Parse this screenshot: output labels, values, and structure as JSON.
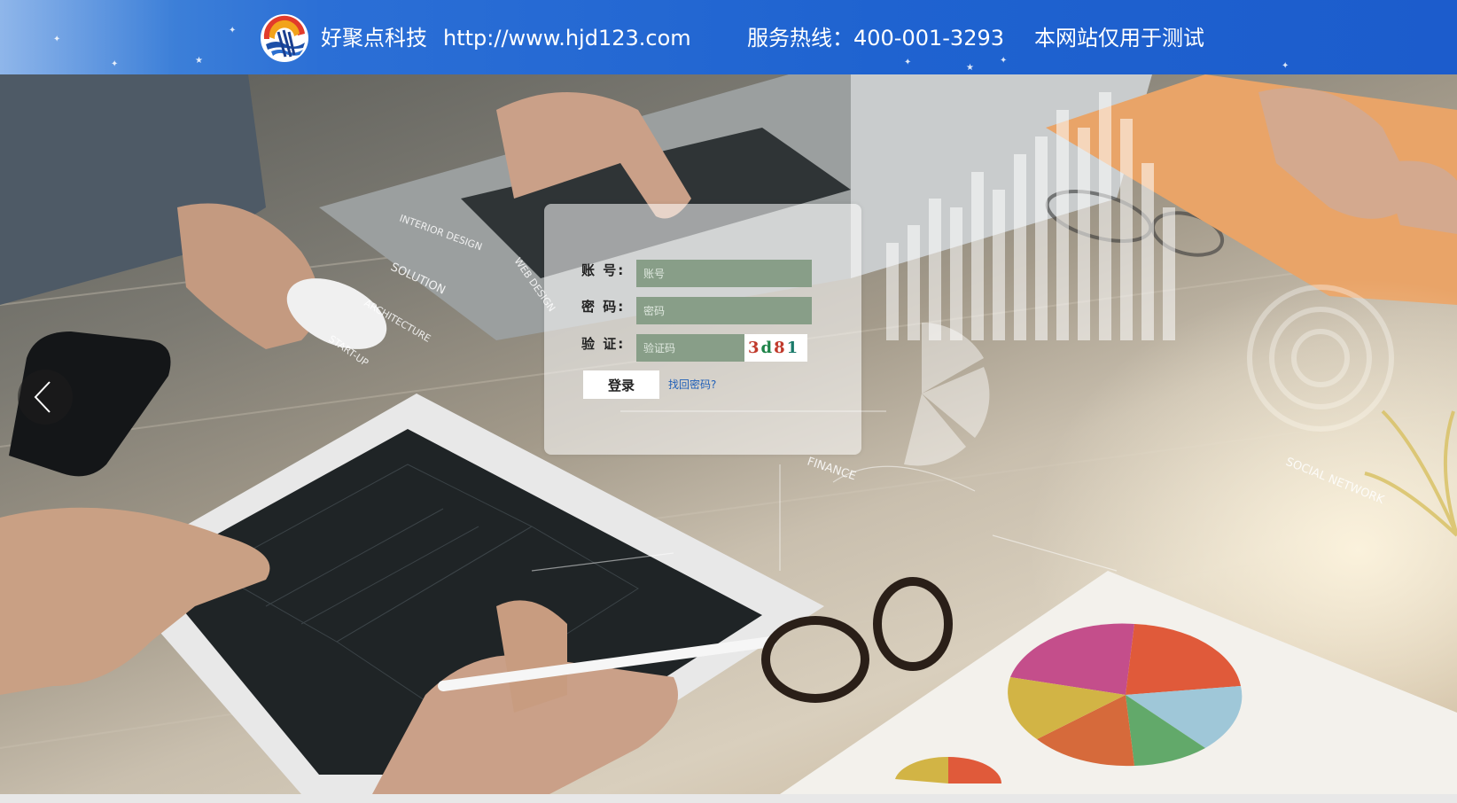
{
  "header": {
    "company": "好聚点科技",
    "url": "http://www.hjd123.com",
    "hotline": "服务热线：400-001-3293",
    "notice": "本网站仅用于测试"
  },
  "login": {
    "account_label": "账  号:",
    "account_placeholder": "账号",
    "password_label": "密  码:",
    "password_placeholder": "密码",
    "captcha_label": "验  证:",
    "captcha_placeholder": "验证码",
    "captcha_chars": [
      {
        "char": "3",
        "color": "#c0392b"
      },
      {
        "char": "d",
        "color": "#1e8449"
      },
      {
        "char": "8",
        "color": "#c0392b"
      },
      {
        "char": "1",
        "color": "#1a7a6a"
      }
    ],
    "submit_label": "登录",
    "forgot_label": "找回密码?"
  },
  "background_texts": {
    "interior_design": "INTERIOR DESIGN",
    "web_design": "WEB DESIGN",
    "solution": "SOLUTION",
    "architecture": "ARCHITECTURE",
    "finance": "FINANCE",
    "social_network": "SOCIAL NETWORK",
    "start_up": "START-UP"
  },
  "icons": {
    "logo": "company-logo-icon",
    "prev": "chevron-left-icon"
  },
  "colors": {
    "header_blue": "#1f63d0",
    "input_green": "#889e88",
    "link_blue": "#1f5fb8"
  }
}
